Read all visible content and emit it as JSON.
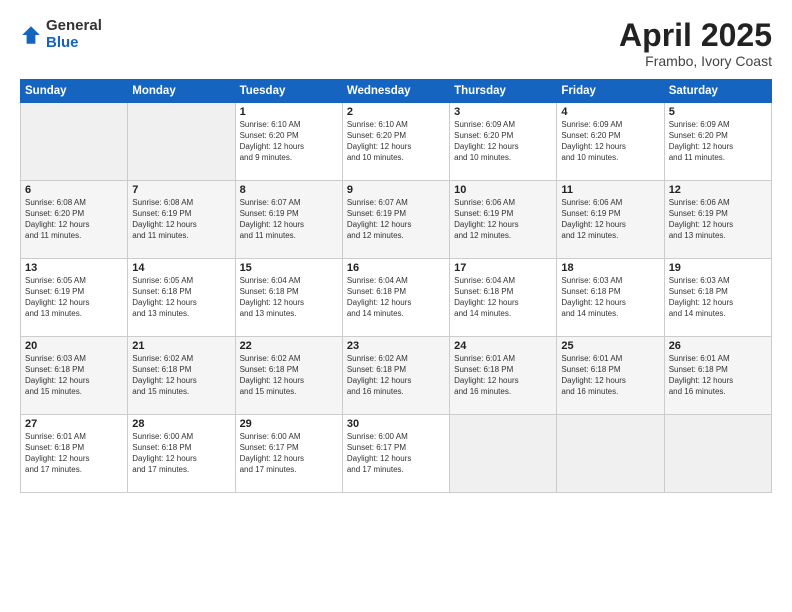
{
  "logo": {
    "general": "General",
    "blue": "Blue"
  },
  "title": "April 2025",
  "subtitle": "Frambo, Ivory Coast",
  "headers": [
    "Sunday",
    "Monday",
    "Tuesday",
    "Wednesday",
    "Thursday",
    "Friday",
    "Saturday"
  ],
  "weeks": [
    [
      {
        "num": "",
        "detail": ""
      },
      {
        "num": "",
        "detail": ""
      },
      {
        "num": "1",
        "detail": "Sunrise: 6:10 AM\nSunset: 6:20 PM\nDaylight: 12 hours\nand 9 minutes."
      },
      {
        "num": "2",
        "detail": "Sunrise: 6:10 AM\nSunset: 6:20 PM\nDaylight: 12 hours\nand 10 minutes."
      },
      {
        "num": "3",
        "detail": "Sunrise: 6:09 AM\nSunset: 6:20 PM\nDaylight: 12 hours\nand 10 minutes."
      },
      {
        "num": "4",
        "detail": "Sunrise: 6:09 AM\nSunset: 6:20 PM\nDaylight: 12 hours\nand 10 minutes."
      },
      {
        "num": "5",
        "detail": "Sunrise: 6:09 AM\nSunset: 6:20 PM\nDaylight: 12 hours\nand 11 minutes."
      }
    ],
    [
      {
        "num": "6",
        "detail": "Sunrise: 6:08 AM\nSunset: 6:20 PM\nDaylight: 12 hours\nand 11 minutes."
      },
      {
        "num": "7",
        "detail": "Sunrise: 6:08 AM\nSunset: 6:19 PM\nDaylight: 12 hours\nand 11 minutes."
      },
      {
        "num": "8",
        "detail": "Sunrise: 6:07 AM\nSunset: 6:19 PM\nDaylight: 12 hours\nand 11 minutes."
      },
      {
        "num": "9",
        "detail": "Sunrise: 6:07 AM\nSunset: 6:19 PM\nDaylight: 12 hours\nand 12 minutes."
      },
      {
        "num": "10",
        "detail": "Sunrise: 6:06 AM\nSunset: 6:19 PM\nDaylight: 12 hours\nand 12 minutes."
      },
      {
        "num": "11",
        "detail": "Sunrise: 6:06 AM\nSunset: 6:19 PM\nDaylight: 12 hours\nand 12 minutes."
      },
      {
        "num": "12",
        "detail": "Sunrise: 6:06 AM\nSunset: 6:19 PM\nDaylight: 12 hours\nand 13 minutes."
      }
    ],
    [
      {
        "num": "13",
        "detail": "Sunrise: 6:05 AM\nSunset: 6:19 PM\nDaylight: 12 hours\nand 13 minutes."
      },
      {
        "num": "14",
        "detail": "Sunrise: 6:05 AM\nSunset: 6:18 PM\nDaylight: 12 hours\nand 13 minutes."
      },
      {
        "num": "15",
        "detail": "Sunrise: 6:04 AM\nSunset: 6:18 PM\nDaylight: 12 hours\nand 13 minutes."
      },
      {
        "num": "16",
        "detail": "Sunrise: 6:04 AM\nSunset: 6:18 PM\nDaylight: 12 hours\nand 14 minutes."
      },
      {
        "num": "17",
        "detail": "Sunrise: 6:04 AM\nSunset: 6:18 PM\nDaylight: 12 hours\nand 14 minutes."
      },
      {
        "num": "18",
        "detail": "Sunrise: 6:03 AM\nSunset: 6:18 PM\nDaylight: 12 hours\nand 14 minutes."
      },
      {
        "num": "19",
        "detail": "Sunrise: 6:03 AM\nSunset: 6:18 PM\nDaylight: 12 hours\nand 14 minutes."
      }
    ],
    [
      {
        "num": "20",
        "detail": "Sunrise: 6:03 AM\nSunset: 6:18 PM\nDaylight: 12 hours\nand 15 minutes."
      },
      {
        "num": "21",
        "detail": "Sunrise: 6:02 AM\nSunset: 6:18 PM\nDaylight: 12 hours\nand 15 minutes."
      },
      {
        "num": "22",
        "detail": "Sunrise: 6:02 AM\nSunset: 6:18 PM\nDaylight: 12 hours\nand 15 minutes."
      },
      {
        "num": "23",
        "detail": "Sunrise: 6:02 AM\nSunset: 6:18 PM\nDaylight: 12 hours\nand 16 minutes."
      },
      {
        "num": "24",
        "detail": "Sunrise: 6:01 AM\nSunset: 6:18 PM\nDaylight: 12 hours\nand 16 minutes."
      },
      {
        "num": "25",
        "detail": "Sunrise: 6:01 AM\nSunset: 6:18 PM\nDaylight: 12 hours\nand 16 minutes."
      },
      {
        "num": "26",
        "detail": "Sunrise: 6:01 AM\nSunset: 6:18 PM\nDaylight: 12 hours\nand 16 minutes."
      }
    ],
    [
      {
        "num": "27",
        "detail": "Sunrise: 6:01 AM\nSunset: 6:18 PM\nDaylight: 12 hours\nand 17 minutes."
      },
      {
        "num": "28",
        "detail": "Sunrise: 6:00 AM\nSunset: 6:18 PM\nDaylight: 12 hours\nand 17 minutes."
      },
      {
        "num": "29",
        "detail": "Sunrise: 6:00 AM\nSunset: 6:17 PM\nDaylight: 12 hours\nand 17 minutes."
      },
      {
        "num": "30",
        "detail": "Sunrise: 6:00 AM\nSunset: 6:17 PM\nDaylight: 12 hours\nand 17 minutes."
      },
      {
        "num": "",
        "detail": ""
      },
      {
        "num": "",
        "detail": ""
      },
      {
        "num": "",
        "detail": ""
      }
    ]
  ]
}
